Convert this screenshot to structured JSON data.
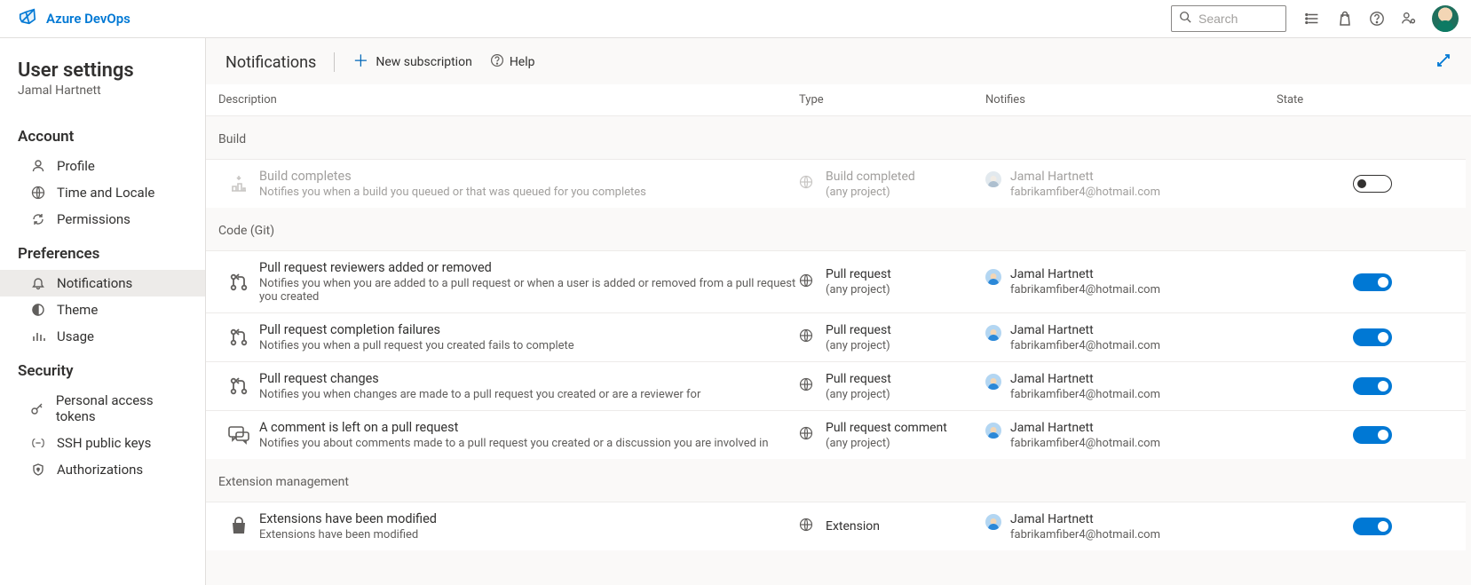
{
  "brand": {
    "name": "Azure DevOps"
  },
  "search": {
    "placeholder": "Search"
  },
  "sidebar": {
    "title": "User settings",
    "subtitle": "Jamal Hartnett",
    "groups": [
      {
        "title": "Account",
        "items": [
          {
            "label": "Profile",
            "icon": "person-icon"
          },
          {
            "label": "Time and Locale",
            "icon": "globe-clock-icon"
          },
          {
            "label": "Permissions",
            "icon": "refresh-icon"
          }
        ]
      },
      {
        "title": "Preferences",
        "items": [
          {
            "label": "Notifications",
            "icon": "bell-icon",
            "active": true
          },
          {
            "label": "Theme",
            "icon": "theme-icon"
          },
          {
            "label": "Usage",
            "icon": "chart-icon"
          }
        ]
      },
      {
        "title": "Security",
        "items": [
          {
            "label": "Personal access tokens",
            "icon": "key-icon"
          },
          {
            "label": "SSH public keys",
            "icon": "ssh-icon"
          },
          {
            "label": "Authorizations",
            "icon": "shield-icon"
          }
        ]
      }
    ]
  },
  "header": {
    "title": "Notifications",
    "new_subscription": "New subscription",
    "help": "Help"
  },
  "columns": {
    "description": "Description",
    "type": "Type",
    "notifies": "Notifies",
    "state": "State"
  },
  "user": {
    "display_name": "Jamal Hartnett",
    "email": "fabrikamfiber4@hotmail.com"
  },
  "groups": [
    {
      "name": "Build",
      "rows": [
        {
          "icon": "build-icon",
          "title": "Build completes",
          "sub": "Notifies you when a build you queued or that was queued for you completes",
          "type_main": "Build completed",
          "type_sub": "(any project)",
          "state": "off"
        }
      ]
    },
    {
      "name": "Code (Git)",
      "rows": [
        {
          "icon": "pr-icon",
          "title": "Pull request reviewers added or removed",
          "sub": "Notifies you when you are added to a pull request or when a user is added or removed from a pull request you created",
          "type_main": "Pull request",
          "type_sub": "(any project)",
          "state": "on"
        },
        {
          "icon": "pr-icon",
          "title": "Pull request completion failures",
          "sub": "Notifies you when a pull request you created fails to complete",
          "type_main": "Pull request",
          "type_sub": "(any project)",
          "state": "on"
        },
        {
          "icon": "pr-icon",
          "title": "Pull request changes",
          "sub": "Notifies you when changes are made to a pull request you created or are a reviewer for",
          "type_main": "Pull request",
          "type_sub": "(any project)",
          "state": "on"
        },
        {
          "icon": "comment-icon",
          "title": "A comment is left on a pull request",
          "sub": "Notifies you about comments made to a pull request you created or a discussion you are involved in",
          "type_main": "Pull request comment",
          "type_sub": "(any project)",
          "state": "on"
        }
      ]
    },
    {
      "name": "Extension management",
      "rows": [
        {
          "icon": "bag-icon",
          "title": "Extensions have been modified",
          "sub": "Extensions have been modified",
          "type_main": "Extension",
          "type_sub": "",
          "state": "on"
        }
      ]
    }
  ]
}
